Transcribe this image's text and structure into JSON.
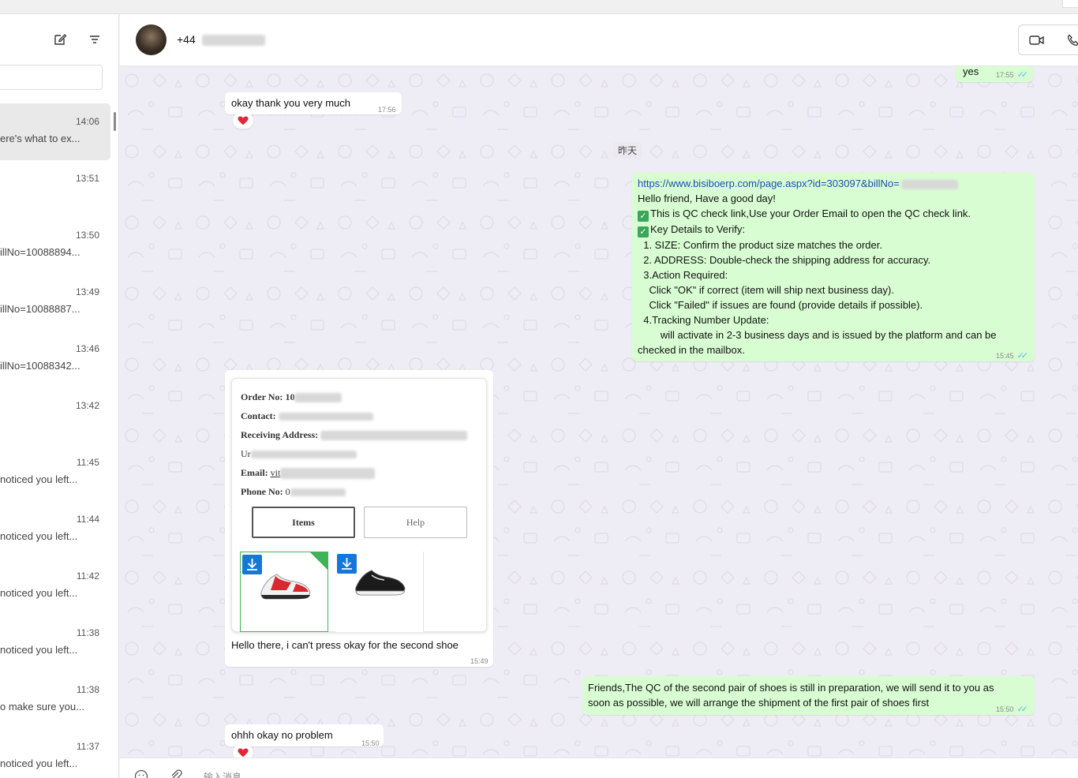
{
  "contact": {
    "name": "+44"
  },
  "sidebar": {
    "chats": [
      {
        "time": "14:06",
        "preview": "ere's what to ex..."
      },
      {
        "time": "13:51",
        "preview": ""
      },
      {
        "time": "13:50",
        "preview": "illNo=10088894..."
      },
      {
        "time": "13:49",
        "preview": "illNo=10088887..."
      },
      {
        "time": "13:46",
        "preview": "illNo=10088342..."
      },
      {
        "time": "13:42",
        "preview": ""
      },
      {
        "time": "11:45",
        "preview": " noticed you left..."
      },
      {
        "time": "11:44",
        "preview": " noticed you left..."
      },
      {
        "time": "11:42",
        "preview": " noticed you left..."
      },
      {
        "time": "11:38",
        "preview": "noticed you left..."
      },
      {
        "time": "11:38",
        "preview": "o make sure you..."
      },
      {
        "time": "11:37",
        "preview": " noticed you left..."
      }
    ]
  },
  "messages": {
    "m1": {
      "text": "yes",
      "time": "17:55"
    },
    "m2": {
      "text": "okay thank you very much",
      "time": "17:56",
      "reaction": "heart"
    },
    "date_divider": "昨天",
    "m3": {
      "link": "https://www.bisiboerp.com/page.aspx?id=303097&billNo=",
      "lines": [
        "Hello friend, Have a good day!",
        "This is QC check link,Use your Order Email to open the QC check link.",
        "Key Details to Verify:",
        "  1. SIZE: Confirm the product size matches the order.",
        "  2. ADDRESS: Double-check the shipping address for accuracy.",
        "  3.Action Required:",
        "    Click \"OK\" if correct (item will ship next business day).",
        "    Click \"Failed\" if issues are found (provide details if possible).",
        "  4.Tracking Number Update:",
        "        will activate in 2-3 business days and is issued by the platform and can be",
        "checked in the mailbox."
      ],
      "time": "15:45"
    },
    "m4": {
      "card": {
        "order_label": "Order No:",
        "order_value": "10",
        "contact_label": "Contact:",
        "address_label": "Receiving Address:",
        "address_line2": "Ur",
        "email_label": "Email:",
        "email_value": "vit",
        "phone_label": "Phone No:",
        "phone_value": "0",
        "items_button": "Items",
        "help_button": "Help"
      },
      "caption": "Hello there, i can't press okay for the second shoe",
      "time": "15:49"
    },
    "m5": {
      "line1": "Friends,The QC of the second pair of shoes is still in preparation, we will send it to you as",
      "line2": "soon as possible, we will arrange the shipment of the first pair of shoes first",
      "time": "15:50"
    },
    "m6": {
      "text": "ohhh okay no problem",
      "time": "15:50",
      "reaction": "heart"
    }
  },
  "composer": {
    "placeholder": "输入消息"
  },
  "colors": {
    "outgoing": "#d9fdd3",
    "incoming": "#ffffff",
    "chat_bg": "#eeecf4",
    "ticks": "#53bdeb"
  }
}
